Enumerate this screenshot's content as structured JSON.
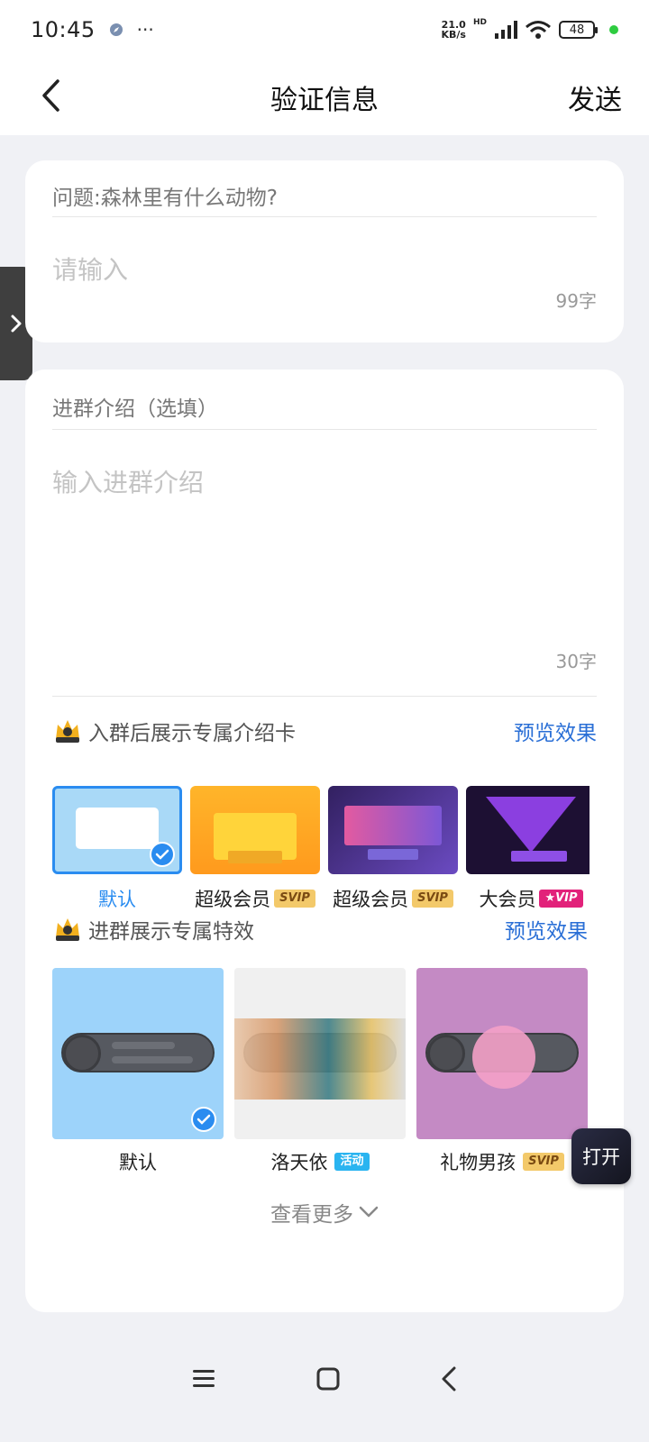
{
  "status_bar": {
    "time": "10:45",
    "more": "···",
    "net_speed_value": "21.0",
    "net_speed_unit": "KB/s",
    "signal_label": "HD",
    "battery": "48"
  },
  "nav": {
    "title": "验证信息",
    "send_label": "发送"
  },
  "question": {
    "label": "问题:森林里有什么动物?",
    "placeholder": "请输入",
    "counter": "99字"
  },
  "intro": {
    "label": "进群介绍（选填）",
    "placeholder": "输入进群介绍",
    "counter": "30字"
  },
  "card_section": {
    "title": "入群后展示专属介绍卡",
    "preview_label": "预览效果",
    "cards": [
      {
        "label": "默认",
        "selected": true
      },
      {
        "label": "超级会员",
        "tag": "SVIP"
      },
      {
        "label": "超级会员",
        "tag": "SVIP"
      },
      {
        "label": "大会员",
        "tag": "★VIP"
      }
    ]
  },
  "effect_section": {
    "title": "进群展示专属特效",
    "preview_label": "预览效果",
    "effects": [
      {
        "label": "默认",
        "selected": true
      },
      {
        "label": "洛天依",
        "tag": "活动"
      },
      {
        "label": "礼物男孩",
        "tag": "SVIP"
      }
    ]
  },
  "see_more": "查看更多",
  "float_button": "打开",
  "colors": {
    "accent_blue": "#2a8cf0",
    "link_blue": "#2a6fd6",
    "background": "#f0f1f5"
  }
}
